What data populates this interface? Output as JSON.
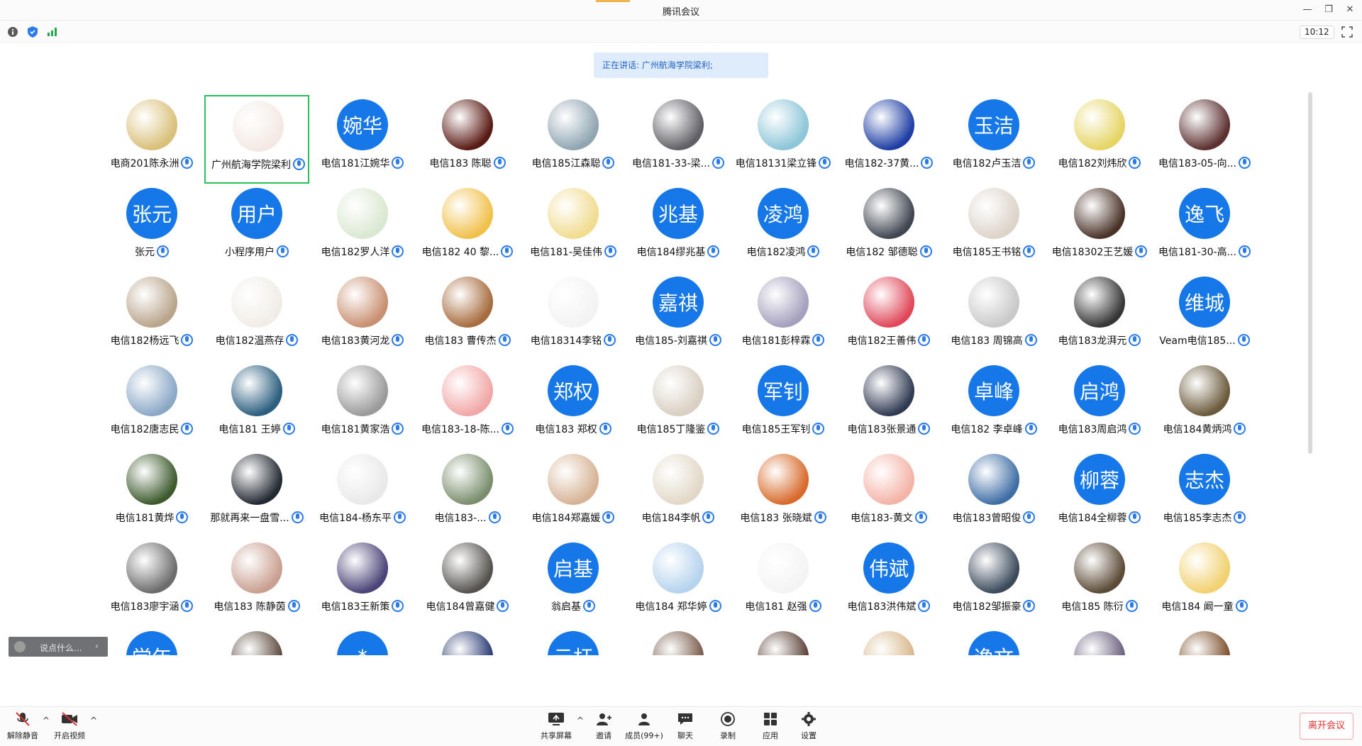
{
  "window": {
    "title": "腾讯会议"
  },
  "clock": "10:12",
  "speaking": "正在讲话: 广州航海学院梁利;",
  "chat_placeholder": "说点什么...",
  "toolbar": {
    "unmute": "解除静音",
    "start_video": "开启视频",
    "share_screen": "共享屏幕",
    "invite": "邀请",
    "members": "成员(99+)",
    "chat": "聊天",
    "record": "录制",
    "apps": "应用",
    "settings": "设置",
    "leave": "离开会议"
  },
  "colors": {
    "accent": "#1677e8",
    "active_border": "#26c15b",
    "leave": "#e03131"
  },
  "participants": [
    {
      "name": "电商201陈永洲",
      "avatar": "photo",
      "color": "#d9c07a"
    },
    {
      "name": "广州航海学院梁利",
      "avatar": "photo",
      "color": "#f4e9e2",
      "active": true
    },
    {
      "name": "电信181江婉华",
      "avatar": "婉华"
    },
    {
      "name": "电信183 陈聪",
      "avatar": "photo",
      "color": "#5a1a14"
    },
    {
      "name": "电信185江森聪",
      "avatar": "photo",
      "color": "#8fa5b2"
    },
    {
      "name": "电信181-33-梁...",
      "avatar": "photo",
      "color": "#5f5f66"
    },
    {
      "name": "电信18131梁立锋",
      "avatar": "photo",
      "color": "#8cc6d8"
    },
    {
      "name": "电信182-37黄...",
      "avatar": "photo",
      "color": "#1e3ea4"
    },
    {
      "name": "电信182卢玉洁",
      "avatar": "玉洁"
    },
    {
      "name": "电信182刘炜欣",
      "avatar": "photo",
      "color": "#e6d565"
    },
    {
      "name": "电信183-05-向...",
      "avatar": "photo",
      "color": "#5d3030"
    },
    {
      "name": "张元",
      "avatar": "张元"
    },
    {
      "name": "小程序用户",
      "avatar": "用户"
    },
    {
      "name": "电信182罗人洋",
      "avatar": "photo",
      "color": "#d9e8d1"
    },
    {
      "name": "电信182 40 黎...",
      "avatar": "photo",
      "color": "#f1c04a"
    },
    {
      "name": "电信181-吴佳伟",
      "avatar": "photo",
      "color": "#f1dc8f"
    },
    {
      "name": "电信184缪兆基",
      "avatar": "兆基"
    },
    {
      "name": "电信182凌鸿",
      "avatar": "凌鸿"
    },
    {
      "name": "电信182 邹德聪",
      "avatar": "photo",
      "color": "#3f4650"
    },
    {
      "name": "电信185王书铭",
      "avatar": "photo",
      "color": "#ddd3c9"
    },
    {
      "name": "电信18302王艺媛",
      "avatar": "photo",
      "color": "#4a3228"
    },
    {
      "name": "电信181-30-高...",
      "avatar": "逸飞"
    },
    {
      "name": "电信182杨远飞",
      "avatar": "photo",
      "color": "#b9a48b"
    },
    {
      "name": "电信182温燕存",
      "avatar": "photo",
      "color": "#f1ece6"
    },
    {
      "name": "电信183黄河龙",
      "avatar": "photo",
      "color": "#c98f71"
    },
    {
      "name": "电信183 曹传杰",
      "avatar": "photo",
      "color": "#a76c3e"
    },
    {
      "name": "电信18314李铭",
      "avatar": "photo",
      "color": "#f3f3f3"
    },
    {
      "name": "电信185-刘嘉祺",
      "avatar": "嘉祺"
    },
    {
      "name": "电信181彭梓霖",
      "avatar": "photo",
      "color": "#a4a0bd"
    },
    {
      "name": "电信182王善伟",
      "avatar": "photo",
      "color": "#e0485a"
    },
    {
      "name": "电信183 周锦高",
      "avatar": "photo",
      "color": "#c9c9c9"
    },
    {
      "name": "电信183龙湃元",
      "avatar": "photo",
      "color": "#363636"
    },
    {
      "name": "Veam电信185...",
      "avatar": "维城"
    },
    {
      "name": "电信182唐志民",
      "avatar": "photo",
      "color": "#8aa7c6"
    },
    {
      "name": "电信181 王婷",
      "avatar": "photo",
      "color": "#2b5e7f"
    },
    {
      "name": "电信181黄家浩",
      "avatar": "photo",
      "color": "#9a9a9a"
    },
    {
      "name": "电信183-18-陈...",
      "avatar": "photo",
      "color": "#f2a6a6"
    },
    {
      "name": "电信183 郑权",
      "avatar": "郑权"
    },
    {
      "name": "电信185丁隆鉴",
      "avatar": "photo",
      "color": "#d9cfc2"
    },
    {
      "name": "电信185王军钊",
      "avatar": "军钊"
    },
    {
      "name": "电信183张景通",
      "avatar": "photo",
      "color": "#303a52"
    },
    {
      "name": "电信182 李卓峰",
      "avatar": "卓峰"
    },
    {
      "name": "电信183周启鸿",
      "avatar": "启鸿"
    },
    {
      "name": "电信184黄炳鸿",
      "avatar": "photo",
      "color": "#6b5a3c"
    },
    {
      "name": "电信181黄烨",
      "avatar": "photo",
      "color": "#3d5a2d"
    },
    {
      "name": "那就再来一盘雪...",
      "avatar": "photo",
      "color": "#232a33"
    },
    {
      "name": "电信184-杨东平",
      "avatar": "photo",
      "color": "#e9e9ea"
    },
    {
      "name": "电信183-...",
      "avatar": "photo",
      "color": "#7a8e6d"
    },
    {
      "name": "电信184郑嘉媛",
      "avatar": "photo",
      "color": "#d6b395"
    },
    {
      "name": "电信184李帆",
      "avatar": "photo",
      "color": "#e2d8c7"
    },
    {
      "name": "电信183 张晓斌",
      "avatar": "photo",
      "color": "#d86a2b"
    },
    {
      "name": "电信183-黄文",
      "avatar": "photo",
      "color": "#f4b3a7"
    },
    {
      "name": "电信183曾昭俊",
      "avatar": "photo",
      "color": "#3f6ea5"
    },
    {
      "name": "电信184全柳蓉",
      "avatar": "柳蓉"
    },
    {
      "name": "电信185李志杰",
      "avatar": "志杰"
    },
    {
      "name": "电信183廖宇涵",
      "avatar": "photo",
      "color": "#6c6c6c"
    },
    {
      "name": "电信183 陈静茵",
      "avatar": "photo",
      "color": "#c99f90"
    },
    {
      "name": "电信183王新策",
      "avatar": "photo",
      "color": "#4b4478"
    },
    {
      "name": "电信184曾嘉健",
      "avatar": "photo",
      "color": "#55524e"
    },
    {
      "name": "翁启基",
      "avatar": "启基"
    },
    {
      "name": "电信184 郑华婷",
      "avatar": "photo",
      "color": "#b5d3ee"
    },
    {
      "name": "电信181 赵强",
      "avatar": "photo",
      "color": "#f4f4f4"
    },
    {
      "name": "电信183洪伟斌",
      "avatar": "伟斌"
    },
    {
      "name": "电信182邹振豪",
      "avatar": "photo",
      "color": "#3b4a5a"
    },
    {
      "name": "电信185 陈衍",
      "avatar": "photo",
      "color": "#5b4a36"
    },
    {
      "name": "电信184 阚一童",
      "avatar": "photo",
      "color": "#f2d170"
    },
    {
      "name": "",
      "avatar": "学年"
    },
    {
      "name": "",
      "avatar": "photo",
      "color": "#5d4b3f"
    },
    {
      "name": "",
      "avatar": "*"
    },
    {
      "name": "",
      "avatar": "photo",
      "color": "#2a3a72"
    },
    {
      "name": "",
      "avatar": "云杆"
    },
    {
      "name": "",
      "avatar": "photo",
      "color": "#7a5b4a"
    },
    {
      "name": "",
      "avatar": "photo",
      "color": "#5a4036"
    },
    {
      "name": "",
      "avatar": "photo",
      "color": "#d8b78a"
    },
    {
      "name": "",
      "avatar": "逸文"
    },
    {
      "name": "",
      "avatar": "photo",
      "color": "#6b5f7e"
    },
    {
      "name": "",
      "avatar": "photo",
      "color": "#7c4f2a"
    }
  ]
}
